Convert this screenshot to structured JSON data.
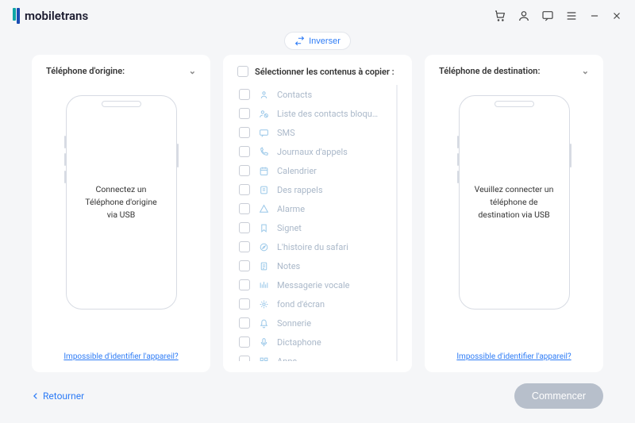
{
  "brand": "mobiletrans",
  "switch_label": "Inverser",
  "panels": {
    "source": {
      "title": "Téléphone d'origine:",
      "msg": "Connectez un Téléphone d'origine via USB",
      "cannot": "Impossible d'identifier l'appareil?"
    },
    "dest": {
      "title": "Téléphone de destination:",
      "msg": "Veuillez connecter un téléphone de destination via USB",
      "cannot": "Impossible d'identifier l'appareil?"
    },
    "select_title": "Sélectionner les contenus à copier :"
  },
  "items": [
    {
      "icon": "contact",
      "label": "Contacts"
    },
    {
      "icon": "block",
      "label": "Liste des contacts bloqu…"
    },
    {
      "icon": "sms",
      "label": "SMS"
    },
    {
      "icon": "phone",
      "label": "Journaux d'appels"
    },
    {
      "icon": "calendar",
      "label": "Calendrier"
    },
    {
      "icon": "reminder",
      "label": "Des rappels"
    },
    {
      "icon": "alarm",
      "label": "Alarme"
    },
    {
      "icon": "bookmark",
      "label": "Signet"
    },
    {
      "icon": "safari",
      "label": "L'histoire du safari"
    },
    {
      "icon": "notes",
      "label": "Notes"
    },
    {
      "icon": "voicemail",
      "label": "Messagerie vocale"
    },
    {
      "icon": "wallpaper",
      "label": "fond d'écran"
    },
    {
      "icon": "ringtone",
      "label": "Sonnerie"
    },
    {
      "icon": "voice",
      "label": "Dictaphone"
    },
    {
      "icon": "apps",
      "label": "Apps"
    }
  ],
  "footer": {
    "back": "Retourner",
    "start": "Commencer"
  }
}
